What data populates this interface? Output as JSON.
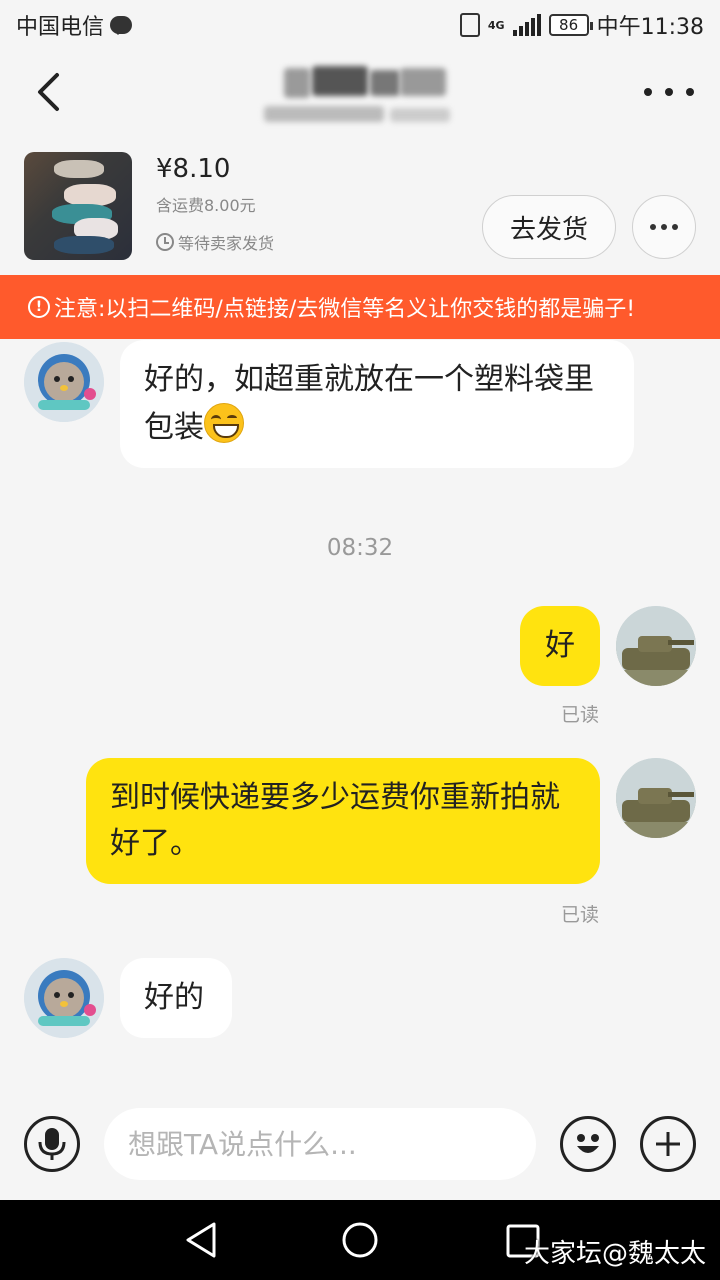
{
  "status_bar": {
    "carrier": "中国电信",
    "network": "4G",
    "battery": "86",
    "time": "中午11:38"
  },
  "order": {
    "price": "¥8.10",
    "shipping_fee": "含运费8.00元",
    "status": "等待卖家发货",
    "ship_button": "去发货"
  },
  "warning": {
    "text": "注意:以扫二维码/点链接/去微信等名义让你交钱的都是骗子!"
  },
  "chat": {
    "messages": [
      {
        "sender": "seller",
        "text": "好的，如超重就放在一个塑料袋里包装"
      },
      {
        "sender": "buyer",
        "text": "好",
        "read": "已读"
      },
      {
        "sender": "buyer",
        "text": "到时候快递要多少运费你重新拍就好了。",
        "read": "已读"
      },
      {
        "sender": "seller",
        "text": "好的"
      }
    ],
    "timestamp": "08:32"
  },
  "input": {
    "placeholder": "想跟TA说点什么..."
  },
  "watermark": "大家坛@魏太太",
  "icons": {
    "back": "back-arrow-icon",
    "more": "more-dots-icon",
    "clock": "clock-icon",
    "warning": "warning-icon",
    "mic": "microphone-icon",
    "emoji": "emoji-icon",
    "plus": "plus-icon"
  },
  "colors": {
    "warning_bg": "#ff5a2c",
    "outgoing_bubble": "#ffe30f",
    "incoming_bubble": "#ffffff",
    "background": "#f5f5f5"
  }
}
